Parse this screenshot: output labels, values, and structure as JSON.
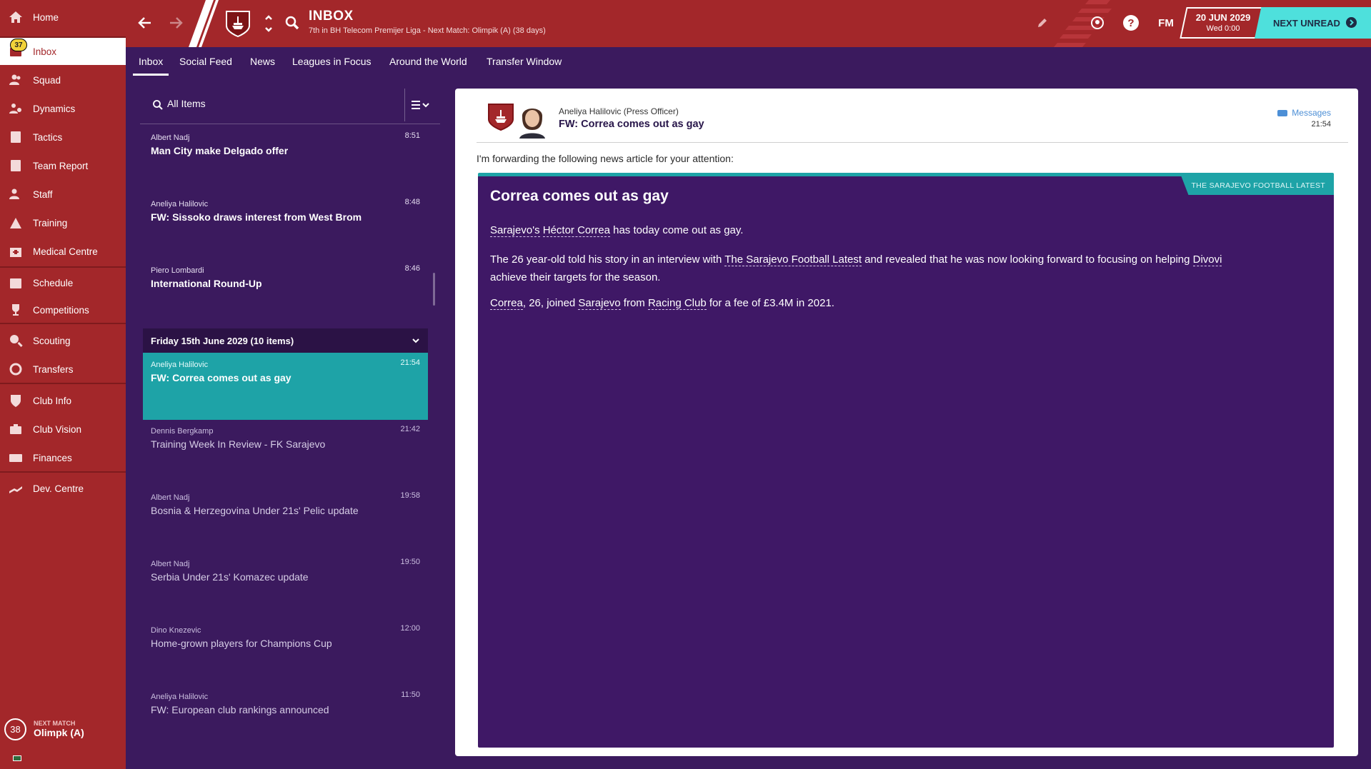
{
  "sidebar": {
    "items": [
      {
        "label": "Home",
        "icon": "home-icon"
      },
      {
        "label": "Inbox",
        "icon": "inbox-icon",
        "badge": "37"
      },
      {
        "label": "Squad",
        "icon": "squad-icon"
      },
      {
        "label": "Dynamics",
        "icon": "dynamics-icon"
      },
      {
        "label": "Tactics",
        "icon": "tactics-icon"
      },
      {
        "label": "Team Report",
        "icon": "team-report-icon"
      },
      {
        "label": "Staff",
        "icon": "staff-icon"
      },
      {
        "label": "Training",
        "icon": "training-icon"
      },
      {
        "label": "Medical Centre",
        "icon": "medical-icon"
      },
      {
        "label": "Schedule",
        "icon": "schedule-icon"
      },
      {
        "label": "Competitions",
        "icon": "trophy-icon"
      },
      {
        "label": "Scouting",
        "icon": "scouting-icon"
      },
      {
        "label": "Transfers",
        "icon": "transfers-icon"
      },
      {
        "label": "Club Info",
        "icon": "club-info-icon"
      },
      {
        "label": "Club Vision",
        "icon": "club-vision-icon"
      },
      {
        "label": "Finances",
        "icon": "finances-icon"
      },
      {
        "label": "Dev. Centre",
        "icon": "dev-centre-icon"
      }
    ],
    "next_match": {
      "label": "NEXT MATCH",
      "value": "Olimpk (A)",
      "days": "38"
    }
  },
  "header": {
    "title": "INBOX",
    "subtitle": "7th in BH Telecom Premijer Liga - Next Match: Olimpik (A) (38 days)",
    "fm_label": "FM",
    "date": "20 JUN 2029",
    "day_time": "Wed 0:00",
    "next_unread": "NEXT UNREAD"
  },
  "tabs": [
    "Inbox",
    "Social Feed",
    "News",
    "Leagues in Focus",
    "Around the World",
    "Transfer Window"
  ],
  "list": {
    "filter_label": "All Items",
    "group_header": "Friday 15th June 2029 (10 items)",
    "messages": [
      {
        "sender": "Albert Nadj",
        "time": "8:51",
        "subject": "Man City make Delgado offer"
      },
      {
        "sender": "Aneliya Halilovic",
        "time": "8:48",
        "subject": "FW: Sissoko draws interest from West Brom"
      },
      {
        "sender": "Piero Lombardi",
        "time": "8:46",
        "subject": "International Round-Up"
      },
      {
        "sender": "Aneliya Halilovic",
        "time": "21:54",
        "subject": "FW: Correa comes out as gay"
      },
      {
        "sender": "Dennis Bergkamp",
        "time": "21:42",
        "subject": "Training Week In Review - FK Sarajevo"
      },
      {
        "sender": "Albert Nadj",
        "time": "19:58",
        "subject": "Bosnia & Herzegovina Under 21s' Pelic update"
      },
      {
        "sender": "Albert Nadj",
        "time": "19:50",
        "subject": "Serbia Under 21s' Komazec update"
      },
      {
        "sender": "Dino Knezevic",
        "time": "12:00",
        "subject": "Home-grown players for Champions Cup"
      },
      {
        "sender": "Aneliya Halilovic",
        "time": "11:50",
        "subject": "FW: European club rankings announced"
      }
    ]
  },
  "reader": {
    "from": "Aneliya Halilovic  (Press Officer)",
    "subject": "FW: Correa comes out as gay",
    "messages_link": "Messages",
    "time": "21:54",
    "intro": "I'm forwarding the following news article for your attention:",
    "article": {
      "source": "THE SARAJEVO FOOTBALL LATEST",
      "headline": "Correa comes out as gay",
      "p1": {
        "a": "Sarajevo's",
        "b": "Héctor Correa",
        "c": " has today come out as gay."
      },
      "p2": {
        "a": "The 26 year-old told his story in an interview with ",
        "b": "The Sarajevo Football Latest",
        "c": " and revealed that he was now looking forward to focusing on helping ",
        "d": "Divovi",
        "e": "achieve their targets for the season."
      },
      "p3": {
        "a": "Correa",
        "b": ", 26, joined ",
        "c": "Sarajevo",
        "d": " from ",
        "e": "Racing Club",
        "f": " for a fee of £3.4M in 2021."
      }
    }
  },
  "colors": {
    "sidebar": "#a3272a",
    "background": "#3b1a5e",
    "accent": "#1ea3a7",
    "next_unread": "#4ee0dc"
  }
}
